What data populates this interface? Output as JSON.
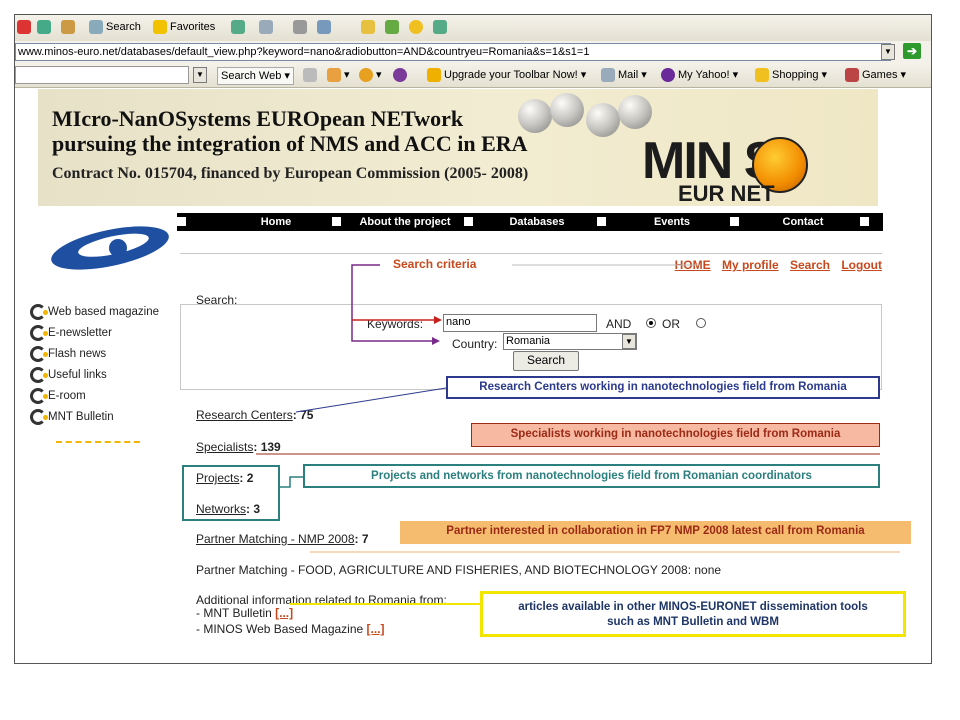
{
  "browser": {
    "toolbar1": {
      "search": "Search",
      "favorites": "Favorites"
    },
    "address": "www.minos-euro.net/databases/default_view.php?keyword=nano&radiobutton=AND&countryeu=Romania&s=1&s1=1",
    "toolbar3": {
      "search_web": "Search Web",
      "upgrade": "Upgrade your Toolbar Now!",
      "mail": "Mail",
      "my_yahoo": "My Yahoo!",
      "shopping": "Shopping",
      "games": "Games"
    }
  },
  "banner": {
    "line1": "MIcro-NanOSystems EUROpean NETwork",
    "line2": "pursuing the integration of NMS and ACC in ERA",
    "line3": "Contract No. 015704, financed by European Commission (2005- 2008)",
    "logo_top": "MIN S",
    "logo_bottom": "EUR   NET"
  },
  "menu": [
    "Home",
    "About the project",
    "Databases",
    "Events",
    "Contact"
  ],
  "sidebar": [
    "Web based magazine",
    "E-newsletter",
    "Flash news",
    "Useful links",
    "E-room",
    "MNT Bulletin"
  ],
  "toplinks": [
    "HOME",
    "My profile",
    "Search",
    "Logout"
  ],
  "search": {
    "heading": "Search:",
    "keywords_label": "Keywords:",
    "keywords_value": "nano",
    "and_label": "AND",
    "or_label": "OR",
    "country_label": "Country:",
    "country_value": "Romania",
    "button": "Search"
  },
  "results": {
    "research_centers_label": "Research Centers",
    "research_centers_count": ": 75",
    "specialists_label": "Specialists",
    "specialists_count": ": 139",
    "projects_label": "Projects",
    "projects_count": ": 2",
    "networks_label": "Networks",
    "networks_count": ": 3",
    "partner_nmp_label": "Partner Matching - NMP 2008",
    "partner_nmp_count": ": 7",
    "partner_food": "Partner Matching - FOOD, AGRICULTURE AND FISHERIES, AND BIOTECHNOLOGY 2008: none",
    "additional": "Additional information related to Romania from:",
    "mnt_bulletin": "- MNT Bulletin",
    "minos_magazine": "- MINOS Web Based Magazine",
    "more_link": "[...]"
  },
  "annotations": {
    "search_criteria": "Search criteria",
    "research": "Research Centers working in nanotechnologies field from Romania",
    "specialists": "Specialists working in nanotechnologies field from Romania",
    "projects": "Projects and networks from nanotechnologies field from Romanian coordinators",
    "partner": "Partner interested in collaboration in FP7 NMP 2008 latest call from Romania",
    "articles_line1": "articles available in other MINOS-EURONET dissemination tools",
    "articles_line2": "such as MNT Bulletin and WBM"
  }
}
